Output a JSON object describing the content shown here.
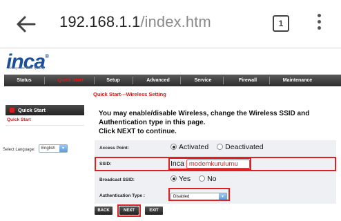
{
  "browser": {
    "url_host": "192.168.1.1",
    "url_path": "/index.htm",
    "tab_count": "1"
  },
  "router": {
    "logo_text": "inca",
    "logo_mark": "®",
    "tagline": "Always the Best Quality",
    "nav": [
      "Status",
      "Quick Start",
      "Setup",
      "Advanced",
      "Service",
      "Firewall",
      "Maintenance"
    ],
    "active_nav": "Quick Start"
  },
  "sidebar": {
    "section": "Quick Start",
    "sub_item": "Quick Start",
    "language_label": "Select Language:",
    "language_value": "English"
  },
  "content": {
    "title": "Quick Start---Wireless Setting",
    "intro_line1": "You may enable/disable Wireless, change the Wireless SSID and",
    "intro_line2": "Authentication type in this page.",
    "intro_line3": "Click NEXT to continue.",
    "access_point": {
      "label": "Access Point:",
      "options": [
        "Activated",
        "Deactivated"
      ],
      "selected": "Activated"
    },
    "ssid": {
      "label": "SSID:",
      "prefix": "Inca",
      "value": "modemkurulumu"
    },
    "broadcast_ssid": {
      "label": "Broadcast SSID:",
      "options": [
        "Yes",
        "No"
      ],
      "selected": "Yes"
    },
    "auth_type": {
      "label": "Authentication Type :",
      "value": "Disabled"
    }
  },
  "buttons": {
    "back": "BACK",
    "next": "NEXT",
    "exit": "EXIT"
  },
  "colors": {
    "accent_red": "#e02020",
    "brand_blue": "#1a4f9c",
    "nav_dark": "#2c2c2c"
  }
}
